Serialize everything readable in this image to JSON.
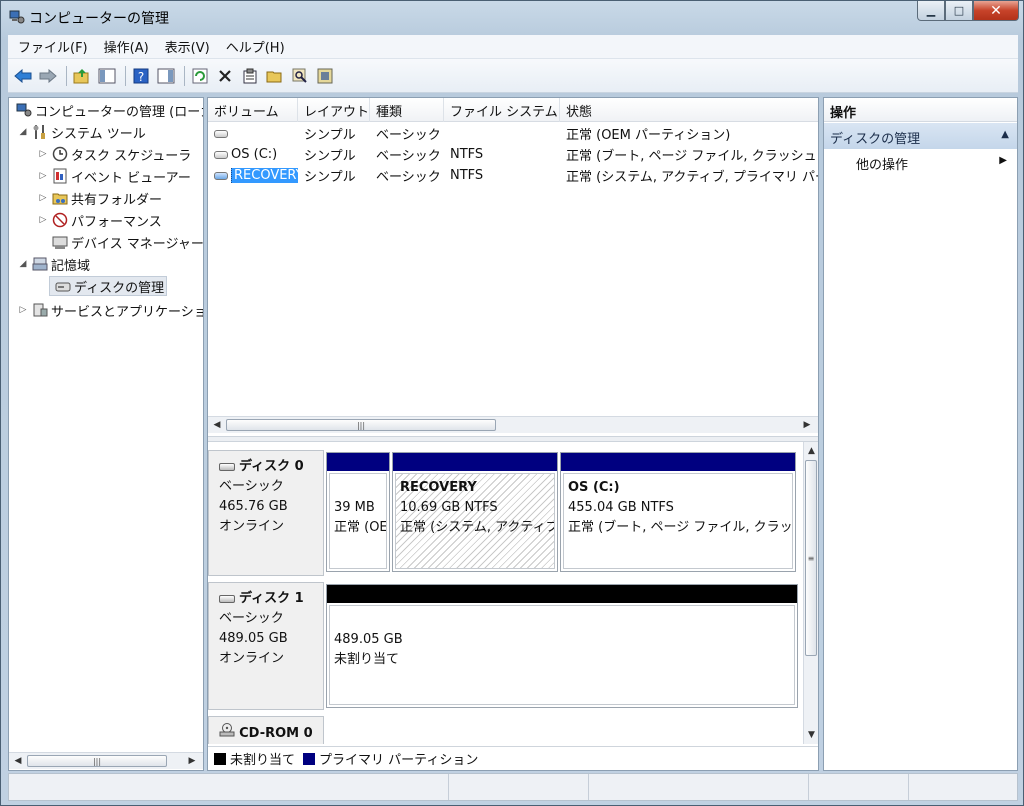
{
  "window": {
    "title": "コンピューターの管理",
    "minimize_glyph": "▁",
    "maximize_glyph": "□",
    "close_glyph": "✕"
  },
  "menu": [
    "ファイル(F)",
    "操作(A)",
    "表示(V)",
    "ヘルプ(H)"
  ],
  "tree": {
    "root": "コンピューターの管理 (ローカ",
    "system_tools": "システム ツール",
    "task_scheduler": "タスク スケジューラ",
    "event_viewer": "イベント ビューアー",
    "shared_folders": "共有フォルダー",
    "performance": "パフォーマンス",
    "device_manager": "デバイス マネージャー",
    "storage": "記憶域",
    "disk_management": "ディスクの管理",
    "services_apps": "サービスとアプリケーショ"
  },
  "volume_list": {
    "headers": [
      "ボリューム",
      "レイアウト",
      "種類",
      "ファイル システム",
      "状態"
    ],
    "rows": [
      {
        "volume": "",
        "layout": "シンプル",
        "type": "ベーシック",
        "fs": "",
        "status": "正常 (OEM パーティション)"
      },
      {
        "volume": "OS (C:)",
        "layout": "シンプル",
        "type": "ベーシック",
        "fs": "NTFS",
        "status": "正常 (ブート, ページ ファイル, クラッシュ ダ"
      },
      {
        "volume": "RECOVERY",
        "layout": "シンプル",
        "type": "ベーシック",
        "fs": "NTFS",
        "status": "正常 (システム, アクティブ, プライマリ パー"
      }
    ]
  },
  "disks": [
    {
      "name": "ディスク 0",
      "type": "ベーシック",
      "size": "465.76 GB",
      "state": "オンライン",
      "partitions": [
        {
          "title": "",
          "line1": "39 MB",
          "line2": "正常 (OE"
        },
        {
          "title": "RECOVERY",
          "line1": "10.69 GB NTFS",
          "line2": "正常 (システム, アクティブ"
        },
        {
          "title": "OS (C:)",
          "line1": "455.04 GB NTFS",
          "line2": "正常 (ブート, ページ ファイル, クラッシ"
        }
      ]
    },
    {
      "name": "ディスク 1",
      "type": "ベーシック",
      "size": "489.05 GB",
      "state": "オンライン",
      "partitions": [
        {
          "title": "",
          "line1": "489.05 GB",
          "line2": "未割り当て"
        }
      ]
    },
    {
      "name": "CD-ROM 0"
    }
  ],
  "legend": [
    {
      "label": "未割り当て",
      "color": "#000000"
    },
    {
      "label": "プライマリ パーティション",
      "color": "#000080"
    }
  ],
  "actions": {
    "header": "操作",
    "section": "ディスクの管理",
    "item": "他の操作"
  },
  "colors": {
    "primary_partition": "#000080",
    "unallocated": "#000000",
    "selection": "#3399ff"
  }
}
